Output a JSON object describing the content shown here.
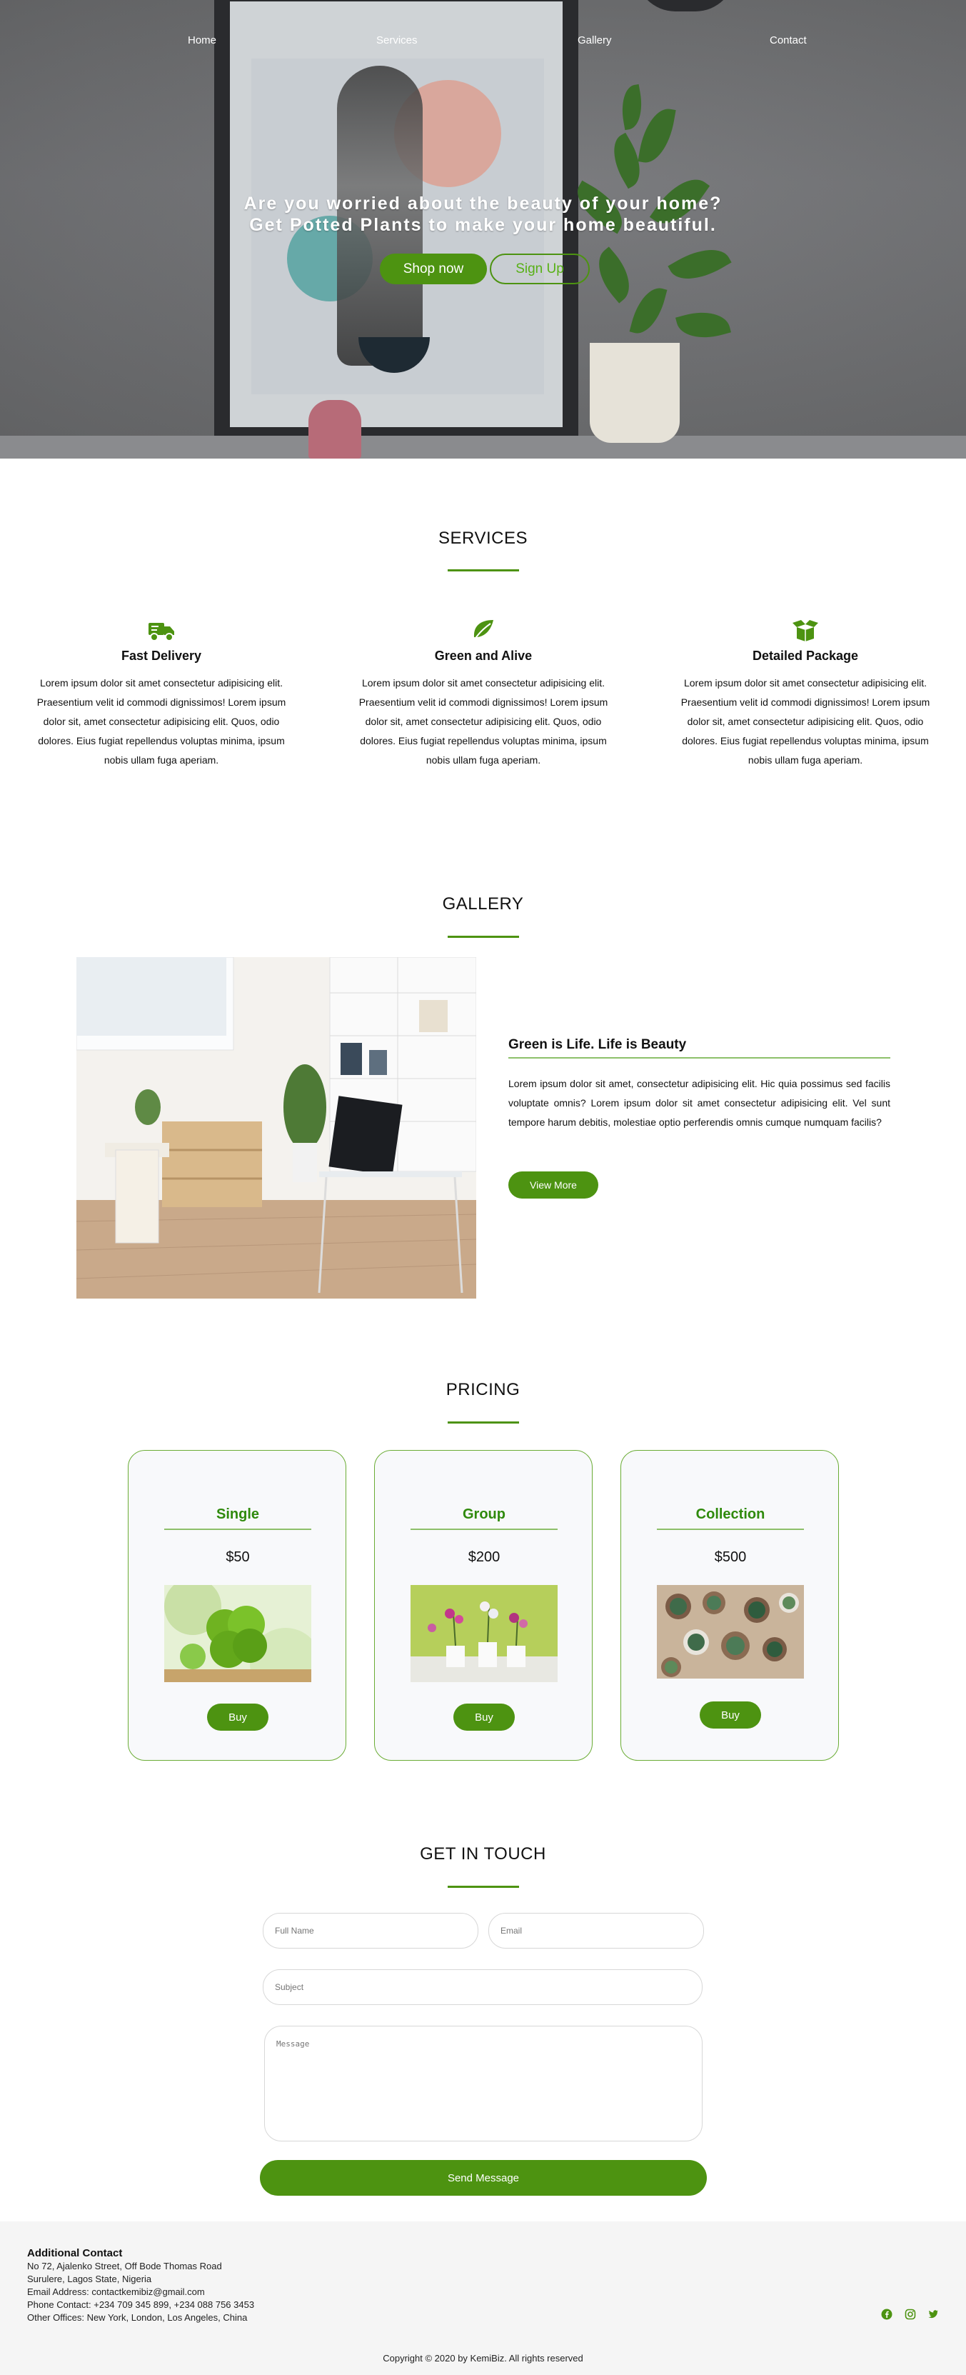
{
  "nav": {
    "items": [
      "Home",
      "Services",
      "Gallery",
      "Contact"
    ]
  },
  "hero": {
    "line1": "Are you worried about the beauty of your home?",
    "line2": "Get Potted Plants to make your home beautiful.",
    "shop_label": "Shop now",
    "signup_label": "Sign Up"
  },
  "services": {
    "title": "SERVICES",
    "items": [
      {
        "icon": "truck-icon",
        "title": "Fast Delivery",
        "text": "Lorem ipsum dolor sit amet consectetur adipisicing elit. Praesentium velit id commodi dignissimos! Lorem ipsum dolor sit, amet consectetur adipisicing elit. Quos, odio dolores. Eius fugiat repellendus voluptas minima, ipsum nobis ullam fuga aperiam."
      },
      {
        "icon": "leaf-icon",
        "title": "Green and Alive",
        "text": "Lorem ipsum dolor sit amet consectetur adipisicing elit. Praesentium velit id commodi dignissimos! Lorem ipsum dolor sit, amet consectetur adipisicing elit. Quos, odio dolores. Eius fugiat repellendus voluptas minima, ipsum nobis ullam fuga aperiam."
      },
      {
        "icon": "box-open-icon",
        "title": "Detailed Package",
        "text": "Lorem ipsum dolor sit amet consectetur adipisicing elit. Praesentium velit id commodi dignissimos! Lorem ipsum dolor sit, amet consectetur adipisicing elit. Quos, odio dolores. Eius fugiat repellendus voluptas minima, ipsum nobis ullam fuga aperiam."
      }
    ]
  },
  "gallery": {
    "title": "GALLERY",
    "heading": "Green is Life. Life is Beauty",
    "text": "Lorem ipsum dolor sit amet, consectetur adipisicing elit. Hic quia possimus sed facilis voluptate omnis? Lorem ipsum dolor sit amet consectetur adipisicing elit. Vel sunt tempore harum debitis, molestiae optio perferendis omnis cumque numquam facilis?",
    "button": "View More"
  },
  "pricing": {
    "title": "PRICING",
    "plans": [
      {
        "name": "Single",
        "price": "$50",
        "button": "Buy"
      },
      {
        "name": "Group",
        "price": "$200",
        "button": "Buy"
      },
      {
        "name": "Collection",
        "price": "$500",
        "button": "Buy"
      }
    ]
  },
  "contact": {
    "title": "GET IN TOUCH",
    "fullname_placeholder": "Full Name",
    "email_placeholder": "Email",
    "subject_placeholder": "Subject",
    "message_placeholder": "Message",
    "send_label": "Send Message"
  },
  "footer": {
    "heading": "Additional Contact",
    "address1": "No 72, Ajalenko Street, Off Bode Thomas Road",
    "address2": "Surulere, Lagos State, Nigeria",
    "email": "Email Address: contactkemibiz@gmail.com",
    "phone": "Phone Contact: +234 709 345 899, +234 088 756 3453",
    "offices": "Other Offices: New York, London, Los Angeles, China",
    "copyright": "Copyright © 2020 by KemiBiz. All rights reserved",
    "social_icons": [
      "facebook-icon",
      "instagram-icon",
      "twitter-icon"
    ]
  },
  "colors": {
    "accent": "#4d9311",
    "accent_light": "#8dc06a",
    "plan_title": "#2f8a0c",
    "footer_bg": "#f5f5f5"
  }
}
